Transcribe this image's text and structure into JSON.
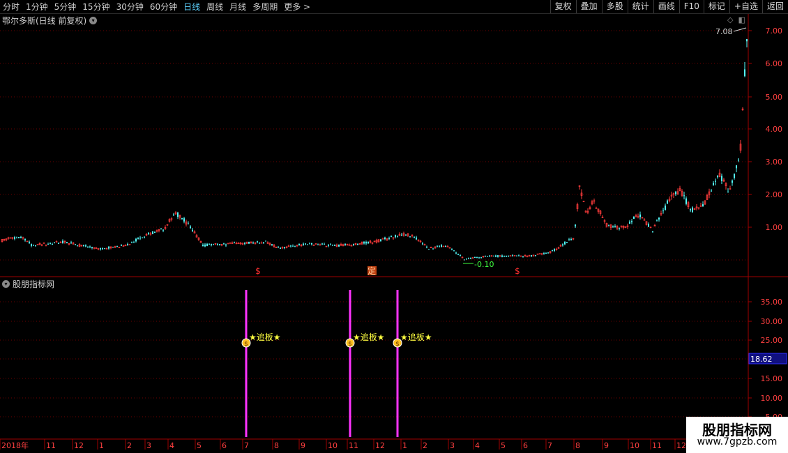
{
  "toolbar": {
    "periods": [
      "分时",
      "1分钟",
      "5分钟",
      "15分钟",
      "30分钟",
      "60分钟",
      "日线",
      "周线",
      "月线",
      "多周期",
      "更多 >"
    ],
    "active_period": "日线",
    "right_buttons": [
      "复权",
      "叠加",
      "多股",
      "统计",
      "画线",
      "F10",
      "标记",
      "+自选",
      "返回"
    ]
  },
  "main_chart": {
    "title": "鄂尔多斯(日线 前复权)",
    "y_ticks": [
      "7.00",
      "6.00",
      "5.00",
      "4.00",
      "3.00",
      "2.00",
      "1.00"
    ],
    "high_label": "7.08",
    "low_label": "-0.10",
    "markers": [
      "$",
      "定",
      "$"
    ]
  },
  "indicator": {
    "title": "股朋指标网",
    "y_ticks": [
      "35.00",
      "30.00",
      "25.00",
      "20.00",
      "15.00",
      "10.00",
      "5.00"
    ],
    "current_value": "18.62",
    "signal_label": "★追板★",
    "signal_count": 3
  },
  "time_axis": {
    "labels": [
      "2018年",
      "11",
      "12",
      "1",
      "2",
      "3",
      "4",
      "5",
      "6",
      "7",
      "8",
      "9",
      "10",
      "11",
      "12",
      "1",
      "2",
      "3",
      "4",
      "5",
      "6",
      "7",
      "8",
      "9",
      "10",
      "11",
      "12"
    ]
  },
  "watermark": {
    "line1": "股朋指标网",
    "line2": "www.7gpzb.com"
  },
  "colors": {
    "up": "#ff3c3c",
    "down": "#54ffff",
    "signal": "#ff33ff",
    "grid": "#6e0000"
  }
}
